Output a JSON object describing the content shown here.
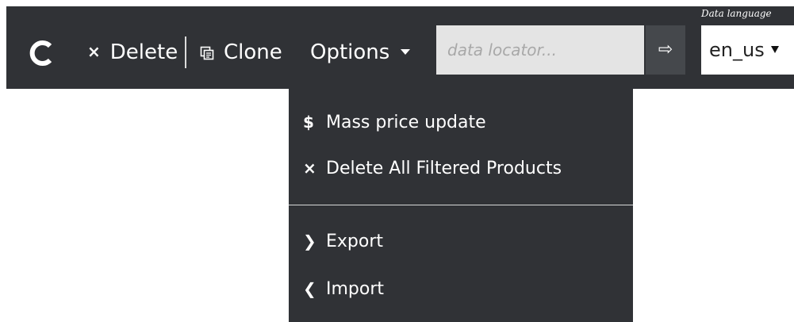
{
  "toolbar": {
    "refresh_icon": "refresh-icon",
    "delete_label": "Delete",
    "delete_icon": "×",
    "clone_label": "Clone",
    "clone_icon": "copy-icon",
    "options_label": "Options",
    "locator_placeholder": "data locator...",
    "go_icon": "⇨",
    "language_label": "Data language",
    "language_value": "en_us",
    "bar_color": "#303236",
    "text_color": "#ffffff"
  },
  "options_menu": {
    "items": [
      {
        "glyph": "$",
        "label": "Mass price update"
      },
      {
        "glyph": "×",
        "label": "Delete All Filtered Products"
      },
      {
        "glyph": "❯",
        "label": "Export"
      },
      {
        "glyph": "❮",
        "label": "Import"
      }
    ]
  }
}
